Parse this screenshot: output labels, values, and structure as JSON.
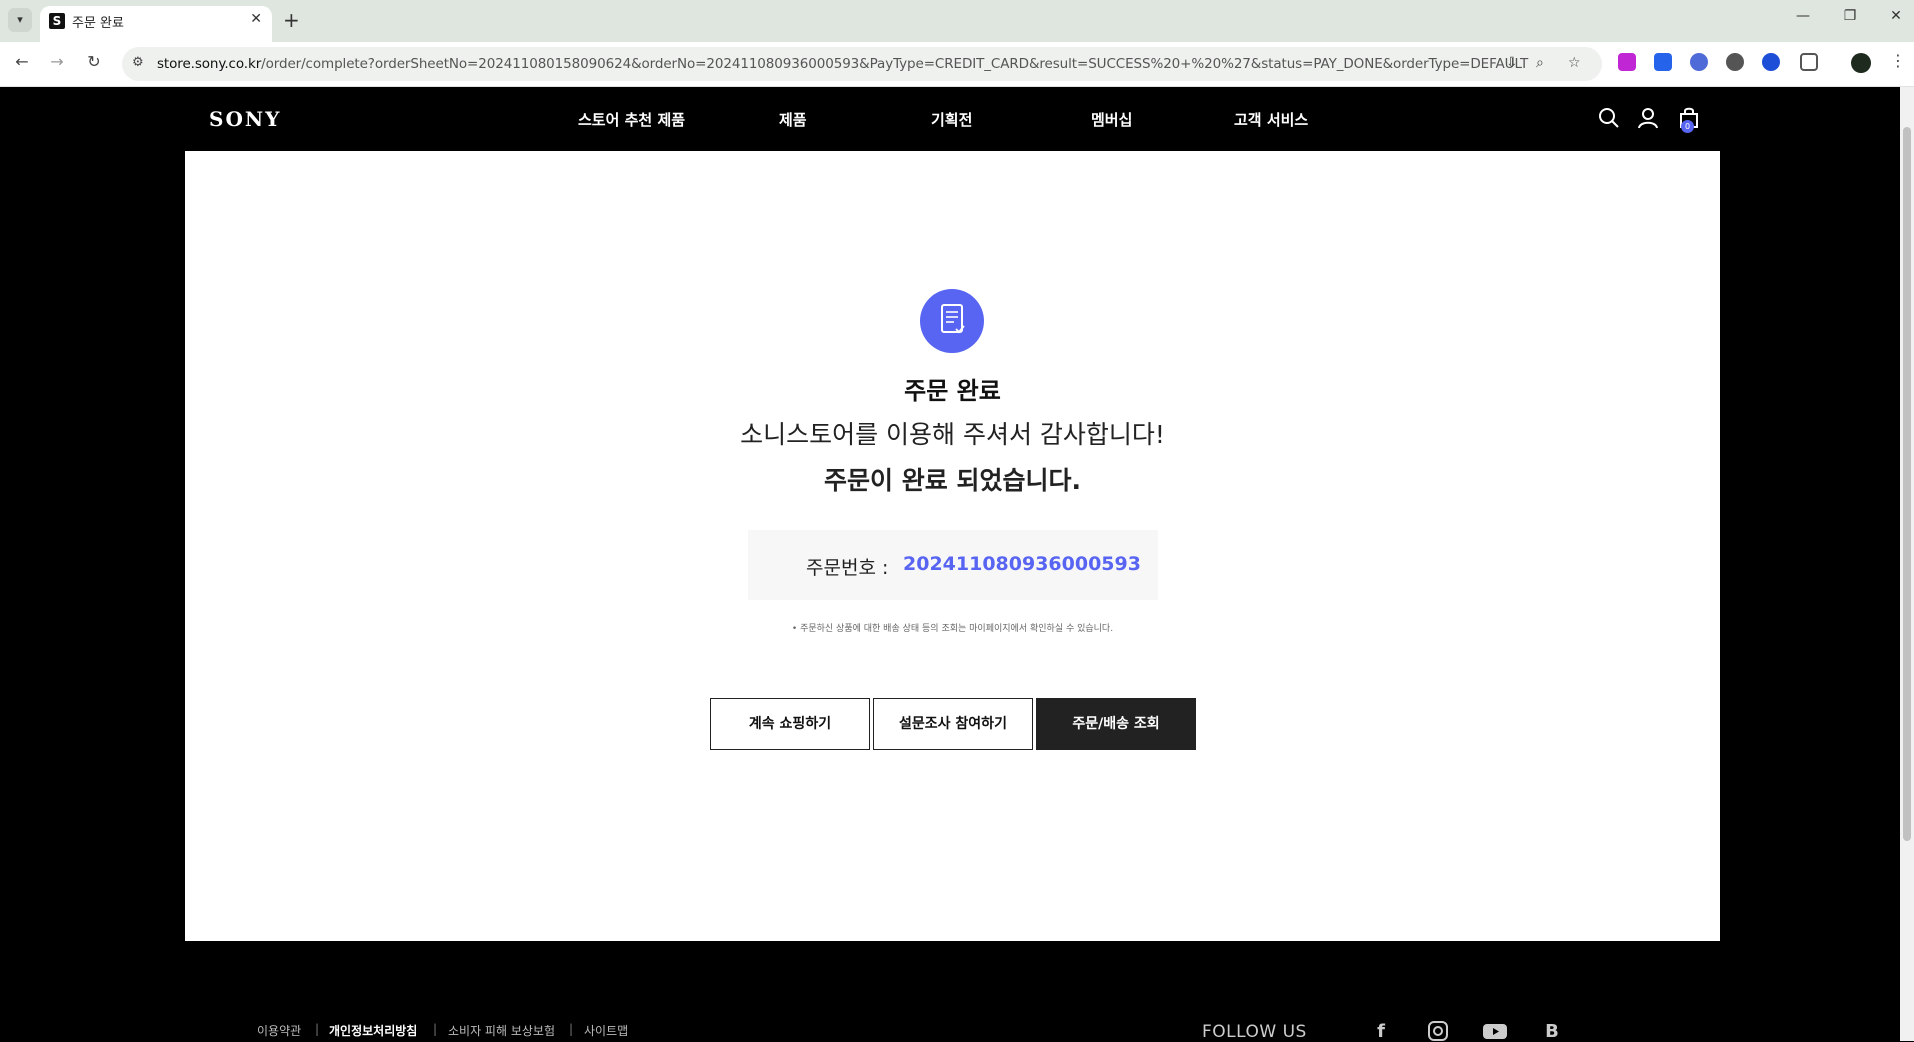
{
  "browser": {
    "tab_title": "주문 완료",
    "tab_favicon": "S",
    "url_host": "store.sony.co.kr",
    "url_path": "/order/complete?orderSheetNo=202411080158090624&orderNo=202411080936000593&PayType=CREDIT_CARD&result=SUCCESS%20+%20%27&status=PAY_DONE&orderType=DEFAULT",
    "icons": {
      "tab_list": "chevron-down-icon",
      "close": "close-icon",
      "new_tab": "plus-icon",
      "back": "arrow-left-icon",
      "forward": "arrow-right-icon",
      "reload": "reload-icon",
      "site_info": "tune-icon",
      "install": "install-icon",
      "zoom": "zoom-icon",
      "bookmark": "star-icon"
    },
    "extension_colors": [
      "#c026d3",
      "#2563eb",
      "#4f6bd8",
      "#555555",
      "#1d4ed8"
    ]
  },
  "header": {
    "logo": "SONY",
    "menu": [
      {
        "label": "스토어 추천 제품"
      },
      {
        "label": "제품"
      },
      {
        "label": "기획전"
      },
      {
        "label": "멤버십"
      },
      {
        "label": "고객 서비스"
      }
    ],
    "cart_count": "0",
    "icons": [
      "search-icon",
      "user-icon",
      "cart-icon"
    ]
  },
  "main": {
    "title": "주문 완료",
    "thanks": "소니스토어를 이용해 주셔서 감사합니다!",
    "done": "주문이 완료 되었습니다.",
    "order_label": "주문번호 :",
    "order_no": "202411080936000593",
    "notice": "• 주문하신 상품에 대한 배송 상태 등의 조회는 마이페이지에서 확인하실 수 있습니다.",
    "buttons": {
      "continue": "계속 쇼핑하기",
      "survey": "설문조사 참여하기",
      "track": "주문/배송 조회"
    },
    "accent_color": "#5865f2"
  },
  "footer": {
    "links": [
      {
        "label": "이용약관"
      },
      {
        "label": "개인정보처리방침"
      },
      {
        "label": "소비자 피해 보상보험"
      },
      {
        "label": "사이트맵"
      }
    ],
    "follow_label": "FOLLOW US",
    "social": [
      "facebook-icon",
      "instagram-icon",
      "youtube-icon",
      "blog-icon"
    ],
    "blog_glyph": "B"
  }
}
